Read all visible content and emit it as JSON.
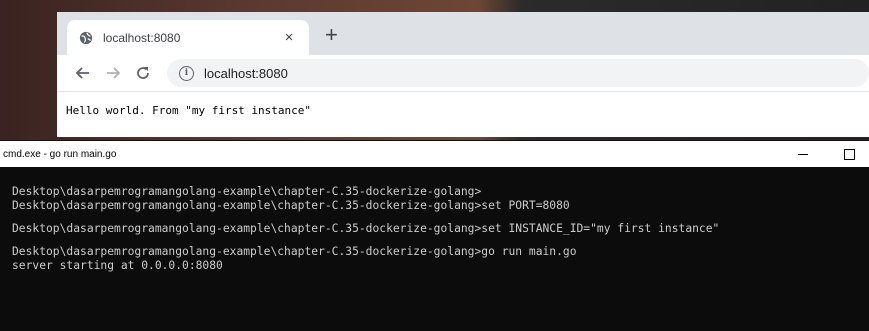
{
  "browser": {
    "tab_title": "localhost:8080",
    "tab_close": "×",
    "new_tab": "+",
    "address": "localhost:8080",
    "info_glyph": "i",
    "page_text": "Hello world. From \"my first instance\""
  },
  "console": {
    "title": "cmd.exe - go  run main.go",
    "lines": [
      "Desktop\\dasarpemrogramangolang-example\\chapter-C.35-dockerize-golang>",
      "Desktop\\dasarpemrogramangolang-example\\chapter-C.35-dockerize-golang>set PORT=8080",
      "Desktop\\dasarpemrogramangolang-example\\chapter-C.35-dockerize-golang>set INSTANCE_ID=\"my first instance\"",
      "Desktop\\dasarpemrogramangolang-example\\chapter-C.35-dockerize-golang>go run main.go",
      "server starting at 0.0.0.0:8080"
    ]
  },
  "colors": {
    "console_bg": "#0c0c0c",
    "console_text": "#cccccc",
    "browser_frame": "#dee1e6"
  },
  "icons": [
    "globe-icon",
    "close-icon",
    "plus-icon",
    "back-arrow-icon",
    "forward-arrow-icon",
    "reload-icon",
    "info-icon",
    "minimize-icon",
    "maximize-icon"
  ]
}
